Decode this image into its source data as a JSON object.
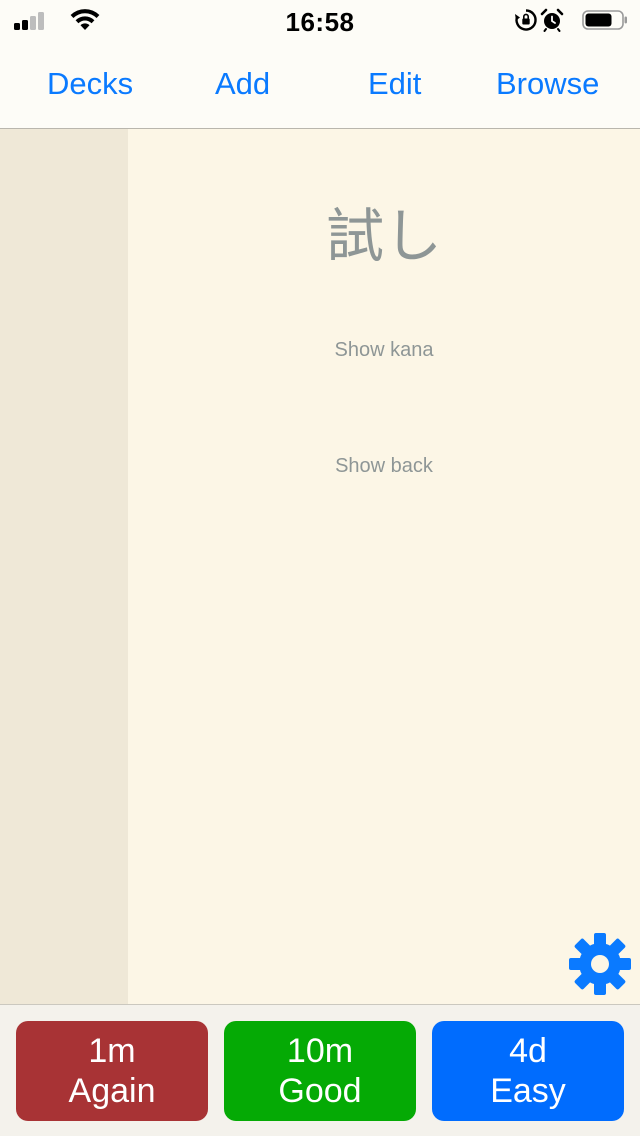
{
  "status": {
    "time": "16:58"
  },
  "nav": {
    "decks": "Decks",
    "add": "Add",
    "edit": "Edit",
    "browse": "Browse"
  },
  "card": {
    "front": "試し",
    "show_kana": "Show kana",
    "show_back": "Show back"
  },
  "answers": [
    {
      "interval": "1m",
      "label": "Again",
      "color": "#a83335"
    },
    {
      "interval": "10m",
      "label": "Good",
      "color": "#05aa05"
    },
    {
      "interval": "4d",
      "label": "Easy",
      "color": "#006cfe"
    }
  ],
  "colors": {
    "accent": "#0a7aff",
    "card_bg": "#fcf6e6",
    "sidebar_bg": "#efe8d7"
  },
  "icons": {
    "settings": "gear-icon"
  }
}
